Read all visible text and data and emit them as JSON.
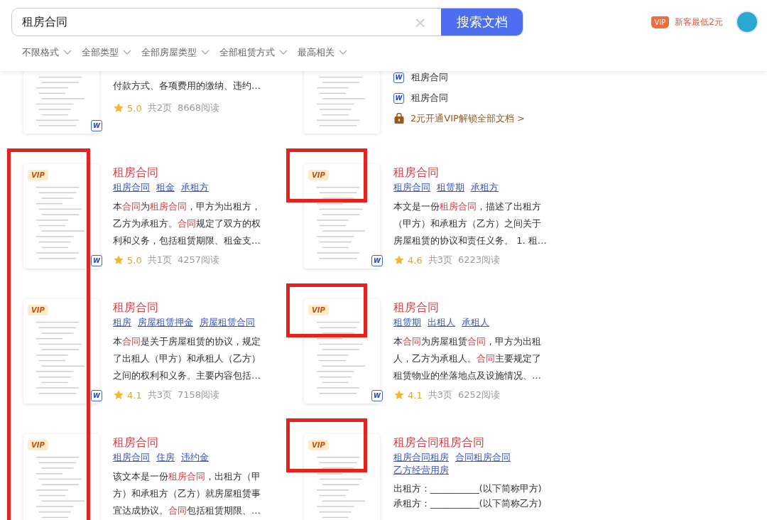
{
  "search": {
    "value": "租房合同",
    "clear": "×",
    "button": "搜索文档"
  },
  "vip_promo": {
    "badge": "VIP",
    "text": "新客最低2元"
  },
  "filters": [
    {
      "label": "不限格式"
    },
    {
      "label": "全部类型"
    },
    {
      "label": "全部房屋类型"
    },
    {
      "label": "全部租赁方式"
    },
    {
      "label": "最高相关"
    }
  ],
  "results": [
    {
      "kind": "partial",
      "thumbnail": {
        "mark": "W"
      },
      "description": [
        "付款方式、各项费用的缴纳、违约…"
      ],
      "rating": "5.0",
      "pages": "共2页",
      "reads": "8668阅读"
    },
    {
      "kind": "related",
      "related": [
        {
          "mark": "W",
          "label": "租房合同"
        },
        {
          "mark": "W",
          "label": "租房合同"
        }
      ],
      "unlock": "2元开通VIP解锁全部文档 >"
    },
    {
      "kind": "doc",
      "thumbnail": {
        "vip": "VIP",
        "mark": "W"
      },
      "thumbnail_framed": true,
      "title": "租房合同",
      "tags": [
        "租房合同",
        "租金",
        "承租方"
      ],
      "description": [
        "本**合同**为**租房合同**，甲方为出租方，乙方为承租方。**合同**规定了双方的权利和义务，包括租赁期限、租金支…"
      ],
      "rating": "5.0",
      "pages": "共1页",
      "reads": "4257阅读"
    },
    {
      "kind": "doc",
      "thumbnail": {
        "vip": "VIP",
        "mark": "W"
      },
      "badge_framed": true,
      "title": "租房合同",
      "tags": [
        "租房合同",
        "租赁期",
        "承租方"
      ],
      "description": [
        "本文是一份**租房合同**，描述了出租方（甲方）和承租方（乙方）之间关于房屋租赁的协议和责任义务。 1. 租…"
      ],
      "rating": "4.6",
      "pages": "共3页",
      "reads": "6223阅读"
    },
    {
      "kind": "doc",
      "thumbnail": {
        "vip": "VIP",
        "mark": "W"
      },
      "thumbnail_framed": true,
      "title": "租房合同",
      "tags": [
        "租房",
        "房屋租赁押金",
        "房屋租赁合同"
      ],
      "description": [
        "本**合同**是关于房屋租赁的协议，规定了出租人（甲方）和承租人（乙方）之间的权利和义务。主要内容包括…"
      ],
      "rating": "4.1",
      "pages": "共3页",
      "reads": "7158阅读"
    },
    {
      "kind": "doc",
      "thumbnail": {
        "vip": "VIP",
        "mark": "W"
      },
      "badge_framed": true,
      "title": "租房合同",
      "tags": [
        "租赁期",
        "出租人",
        "承租人"
      ],
      "description": [
        "本**合同**为房屋租赁**合同**，甲方为出租人，乙方为承租人。**合同**主要规定了租赁物业的坐落地点及设施情况、…"
      ],
      "rating": "4.1",
      "pages": "共3页",
      "reads": "6252阅读"
    },
    {
      "kind": "doc",
      "thumbnail": {
        "vip": "VIP"
      },
      "thumbnail_framed": true,
      "title": "租房合同",
      "tags": [
        "租房合同",
        "住房",
        "违约金"
      ],
      "description": [
        "该文本是一份**租房合同**，出租方（甲方）和承租方（乙方）就房屋租赁事宜达成协议。**合同**包括租赁期限、…"
      ]
    },
    {
      "kind": "lines",
      "thumbnail": {
        "vip": "VIP"
      },
      "badge_framed": true,
      "title": "租房合同租房合同",
      "tags": [
        "租房合同租房",
        "合同租房合同",
        "乙方经营用房"
      ],
      "description": [
        "出租方：___________(以下简称甲方)",
        "承租方：___________(以下简称乙方)"
      ]
    }
  ]
}
